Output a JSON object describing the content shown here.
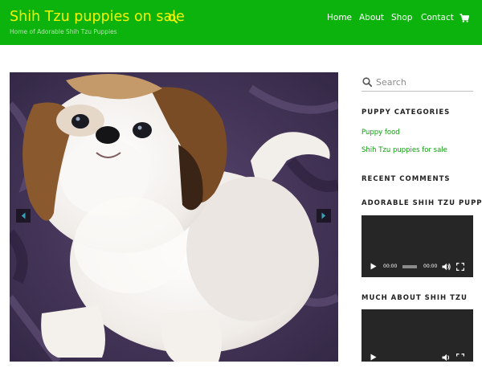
{
  "site": {
    "title": "Shih Tzu puppies on sale",
    "tagline": "Home of Adorable Shih Tzu Puppies"
  },
  "nav": {
    "items": [
      "Home",
      "About",
      "Shop",
      "Contact"
    ]
  },
  "icons": {
    "header_search": "search-icon",
    "cart": "shopping-cart-icon",
    "slider_prev": "chevron-left-icon",
    "slider_next": "chevron-right-icon",
    "sidebar_search": "search-icon",
    "play": "play-icon",
    "volume": "volume-icon",
    "fullscreen": "fullscreen-icon"
  },
  "sidebar": {
    "search": {
      "placeholder": "Search"
    },
    "categories": {
      "title": "PUPPY CATEGORIES",
      "items": [
        "Puppy food",
        "Shih Tzu puppies for sale"
      ]
    },
    "recent_comments": {
      "title": "RECENT COMMENTS"
    },
    "video1": {
      "title": "ADORABLE SHIH TZU PUPPIES",
      "current_time": "00:00",
      "duration": "00:00"
    },
    "video2": {
      "title": "MUCH ABOUT SHIH TZU"
    }
  },
  "colors": {
    "header_bg": "#0cb30c",
    "title": "#f4f400",
    "link": "#0aa00a",
    "video_bg": "#262626"
  }
}
